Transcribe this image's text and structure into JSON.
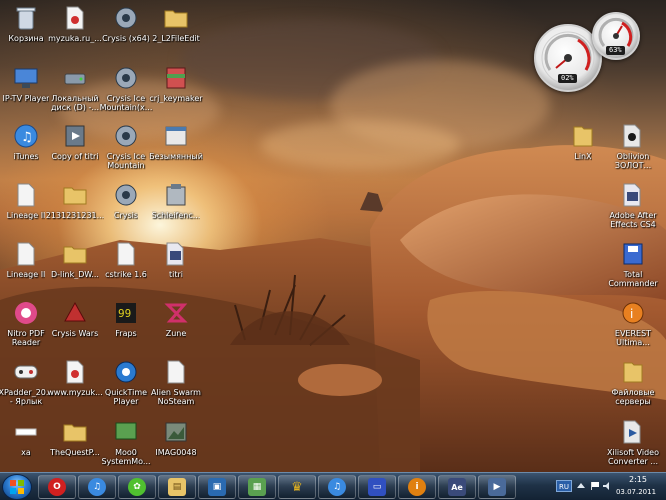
{
  "desktop": {
    "icons": [
      {
        "label": "Корзина",
        "icon": "recycle-bin-icon",
        "color": "#cfd8e4"
      },
      {
        "label": "myzuka.ru_...",
        "icon": "document-icon",
        "color": "#f4f4f4"
      },
      {
        "label": "Crysis (x64)",
        "icon": "crysis-icon",
        "color": "#9aa8b8"
      },
      {
        "label": "2_L2FileEdit",
        "icon": "folder-icon",
        "color": "#e8c468"
      },
      {
        "label": "IP-TV Player",
        "icon": "iptv-icon",
        "color": "#4a86d8"
      },
      {
        "label": "Локальный диск (D) -...",
        "icon": "drive-icon",
        "color": "#8a9aaa"
      },
      {
        "label": "Crysis Ice Mountain(x...",
        "icon": "crysis-icon",
        "color": "#9aa8b8"
      },
      {
        "label": "crj_keymaker",
        "icon": "archive-icon",
        "color": "#d05050"
      },
      {
        "label": "iTunes",
        "icon": "itunes-icon",
        "color": "#3a8ae0"
      },
      {
        "label": "Copy of titri",
        "icon": "video-icon",
        "color": "#6a7a8a"
      },
      {
        "label": "Crysis Ice Mountain",
        "icon": "crysis-icon",
        "color": "#9aa8b8"
      },
      {
        "label": "Безымянный",
        "icon": "window-icon",
        "color": "#e8e8e8"
      },
      {
        "label": "Lineage II",
        "icon": "document-icon",
        "color": "#f4f4f4"
      },
      {
        "label": "2131231231...",
        "icon": "folder-icon",
        "color": "#e8c468"
      },
      {
        "label": "Crysis",
        "icon": "crysis-icon",
        "color": "#9aa8b8"
      },
      {
        "label": "Schleifenc...",
        "icon": "setup-icon",
        "color": "#b0b8c0"
      },
      {
        "label": "Lineage II",
        "icon": "document-icon",
        "color": "#f4f4f4"
      },
      {
        "label": "D-link_DW...",
        "icon": "folder-icon",
        "color": "#e8c468"
      },
      {
        "label": "cstrike 1.6",
        "icon": "document-icon",
        "color": "#f4f4f4"
      },
      {
        "label": "titri",
        "icon": "after-effects-icon",
        "color": "#5a6a9a"
      },
      {
        "label": "Nitro PDF Reader",
        "icon": "nitro-pdf-icon",
        "color": "#e04a8a"
      },
      {
        "label": "Crysis Wars",
        "icon": "crysis-wars-icon",
        "color": "#c03030"
      },
      {
        "label": "Fraps",
        "icon": "fraps-icon",
        "color": "#e0d020"
      },
      {
        "label": "Zune",
        "icon": "zune-icon",
        "color": "#d0306a"
      },
      {
        "label": "XPadder_20... - Ярлык",
        "icon": "gamepad-icon",
        "color": "#f0f0f0"
      },
      {
        "label": "www.myzuk...",
        "icon": "document-icon",
        "color": "#f4f4f4"
      },
      {
        "label": "QuickTime Player",
        "icon": "quicktime-icon",
        "color": "#2a7ad0"
      },
      {
        "label": "Alien Swarm NoSteam",
        "icon": "document-icon",
        "color": "#f4f4f4"
      },
      {
        "label": "xa",
        "icon": "blank-icon",
        "color": "#ffffff"
      },
      {
        "label": "TheQuestP...",
        "icon": "folder-icon",
        "color": "#e8c468"
      },
      {
        "label": "Moo0 SystemMo...",
        "icon": "monitor-icon",
        "color": "#5aa050"
      },
      {
        "label": "IMAG0048",
        "icon": "image-icon",
        "color": "#7a8a7a"
      },
      {
        "label": "LinX",
        "icon": "folder-icon",
        "color": "#e8c468"
      },
      {
        "label": "Oblivion ЗОЛОТ...",
        "icon": "oblivion-icon",
        "color": "#e8e8e8"
      },
      {
        "label": "Adobe After Effects CS4",
        "icon": "after-effects-icon",
        "color": "#5a6a9a"
      },
      {
        "label": "Total Commander",
        "icon": "total-commander-icon",
        "color": "#3a6ad0"
      },
      {
        "label": "EVEREST Ultima...",
        "icon": "everest-icon",
        "color": "#e88020"
      },
      {
        "label": "Файловые серверы",
        "icon": "folder-icon",
        "color": "#e8c468"
      },
      {
        "label": "Xilisoft Video Converter ...",
        "icon": "video-converter-icon",
        "color": "#e8e8e8"
      }
    ],
    "gadgets": {
      "cpu_meter": {
        "cpu_percent": "02%",
        "memory_percent": "63%"
      }
    }
  },
  "taskbar": {
    "start_icon": "windows-logo-icon",
    "pinned": [
      {
        "name": "opera",
        "icon": "opera-icon",
        "color": "#d02020",
        "glyph": "O"
      },
      {
        "name": "itunes",
        "icon": "itunes-icon",
        "color": "#3a8ae0",
        "glyph": "♫"
      },
      {
        "name": "icq",
        "icon": "icq-icon",
        "color": "#50c030",
        "glyph": "✿"
      },
      {
        "name": "explorer",
        "icon": "folder-icon",
        "color": "#e8c468",
        "glyph": "▤"
      },
      {
        "name": "remote-desktop",
        "icon": "monitor-icon",
        "color": "#2a6ab0",
        "glyph": "▣"
      },
      {
        "name": "system-monitor",
        "icon": "monitor-icon",
        "color": "#5aa050",
        "glyph": "▦"
      },
      {
        "name": "crown-app",
        "icon": "crown-icon",
        "color": "#e0b020",
        "glyph": "♛"
      },
      {
        "name": "itunes-2",
        "icon": "itunes-icon",
        "color": "#3a8ae0",
        "glyph": "♫"
      },
      {
        "name": "save-app",
        "icon": "floppy-icon",
        "color": "#3050c0",
        "glyph": "▭"
      },
      {
        "name": "info-app",
        "icon": "info-icon",
        "color": "#e08010",
        "glyph": "i"
      },
      {
        "name": "after-effects",
        "icon": "after-effects-icon",
        "color": "#3a4a7a",
        "glyph": "Ae"
      },
      {
        "name": "video-converter",
        "icon": "video-converter-icon",
        "color": "#4a6a9a",
        "glyph": "▶"
      }
    ],
    "tray": {
      "language": "RU",
      "time": "2:15",
      "date": "03.07.2011"
    }
  }
}
